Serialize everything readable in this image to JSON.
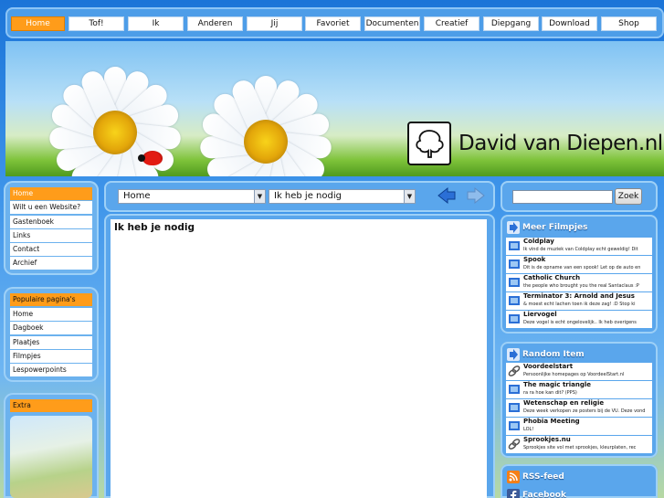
{
  "nav": {
    "items": [
      {
        "label": "Home",
        "active": true
      },
      {
        "label": "Tof!"
      },
      {
        "label": "Ik"
      },
      {
        "label": "Anderen"
      },
      {
        "label": "Jij"
      },
      {
        "label": "Favoriet"
      },
      {
        "label": "Documenten"
      },
      {
        "label": "Creatief"
      },
      {
        "label": "Diepgang"
      },
      {
        "label": "Download"
      },
      {
        "label": "Shop"
      }
    ]
  },
  "banner": {
    "site_title": "David van Diepen.nl"
  },
  "sidebar": {
    "main_menu": [
      "Home",
      "Wilt u een Website?",
      "Gastenboek",
      "Links",
      "Contact",
      "Archief"
    ],
    "popular": {
      "title": "Populaire pagina's",
      "items": [
        "Home",
        "Dagboek",
        "Plaatjes",
        "Filmpjes",
        "Lespowerpoints"
      ]
    },
    "extra": {
      "title": "Extra"
    }
  },
  "toolbar": {
    "section_select": "Home",
    "page_select": "Ik heb je nodig"
  },
  "content": {
    "title": "Ik heb je nodig"
  },
  "search": {
    "button_label": "Zoek"
  },
  "meer_filmpjes": {
    "title": "Meer Filmpjes",
    "items": [
      {
        "title": "Coldplay",
        "desc": "Ik vind de muziek van Coldplay echt geweldig! Dit"
      },
      {
        "title": "Spook",
        "desc": "Dit is de opname van een spook! Let op de auto en"
      },
      {
        "title": "Catholic Church",
        "desc": "the people who brought you the real Santaclaus :P"
      },
      {
        "title": "Terminator 3: Arnold and Jesus",
        "desc": "& moest echt lachen toen ik deze zag! :D Stop ki"
      },
      {
        "title": "Liervogel",
        "desc": "Deze vogel is echt ongelovelijk.. Ik heb overigens"
      }
    ]
  },
  "random_item": {
    "title": "Random Item",
    "items": [
      {
        "title": "Voordeelstart",
        "desc": "Persoonlijke homepages op VoordeelStart.nl",
        "icon": "link-icon"
      },
      {
        "title": "The magic triangle",
        "desc": "ra ra hoe kan dit? (PPS)",
        "icon": "film-icon"
      },
      {
        "title": "Wetenschap en religie",
        "desc": "Deze week verkopen ze posters bij de VU. Deze vond",
        "icon": "film-icon"
      },
      {
        "title": "Phobia Meeting",
        "desc": "LOL!",
        "icon": "film-icon"
      },
      {
        "title": "Sprookjes.nu",
        "desc": "Sprookjes site vol met sprookjes, kleurplaten, rec",
        "icon": "link-icon"
      }
    ]
  },
  "feeds": {
    "rss": "RSS-feed",
    "facebook": "Facebook"
  },
  "colors": {
    "accent_orange": "#ff9c1a",
    "frame_blue": "#5aa6ec"
  }
}
